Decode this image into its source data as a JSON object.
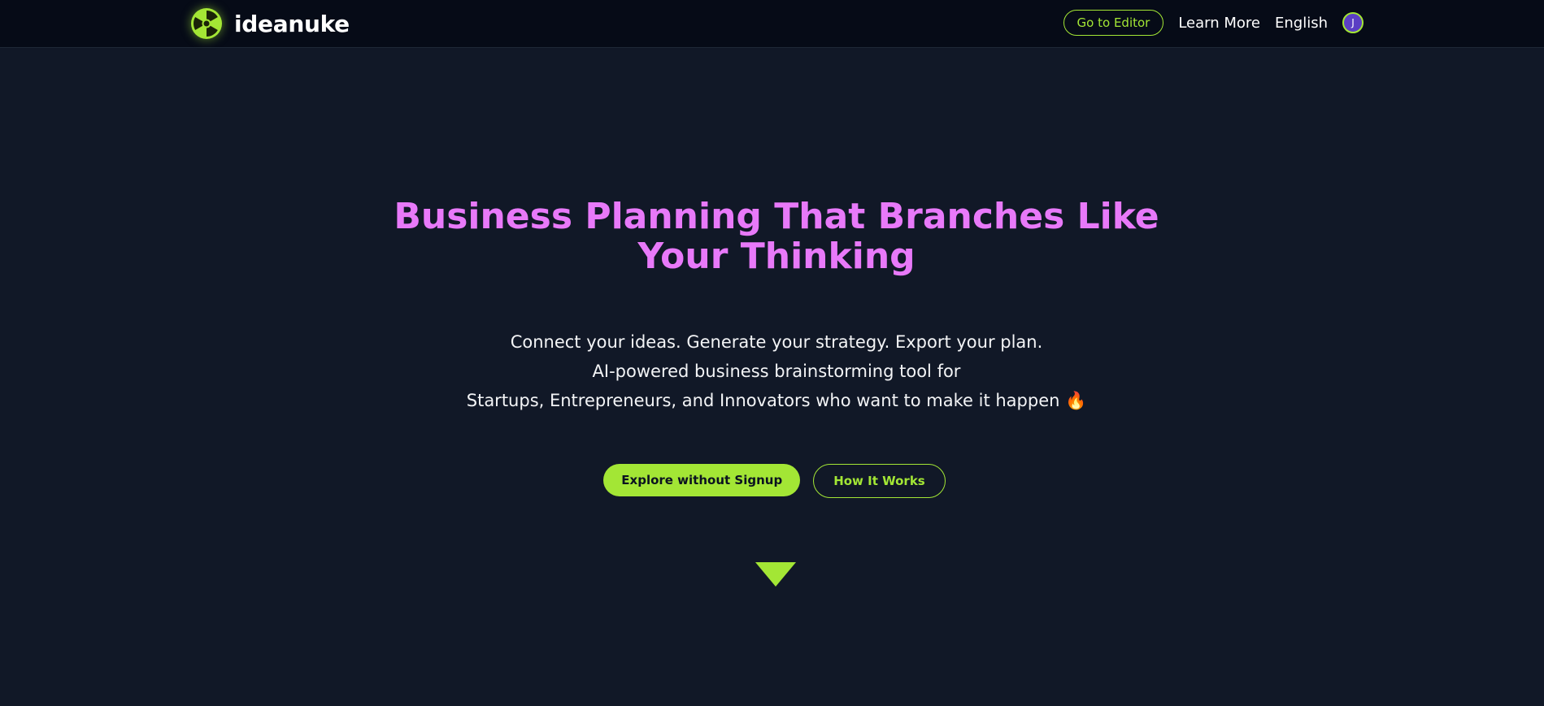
{
  "header": {
    "brand_name": "ideanuke",
    "go_to_editor_label": "Go to Editor",
    "learn_more_label": "Learn More",
    "language_label": "English",
    "avatar_initial": "J"
  },
  "hero": {
    "title": "Business Planning That Branches Like Your Thinking",
    "subtitle_lines": [
      "Connect your ideas. Generate your strategy. Export your plan.",
      "AI-powered business brainstorming tool for",
      "Startups, Entrepreneurs, and Innovators who want to make it happen 🔥"
    ],
    "primary_cta_label": "Explore without Signup",
    "secondary_cta_label": "How It Works"
  },
  "icons": {
    "logo": "radiation-icon",
    "scroll": "triangle-down-icon"
  },
  "colors": {
    "background": "#111827",
    "header_background": "#060b17",
    "accent": "#a3e635",
    "title": "#e879f9",
    "avatar": "#5b3fc4"
  }
}
